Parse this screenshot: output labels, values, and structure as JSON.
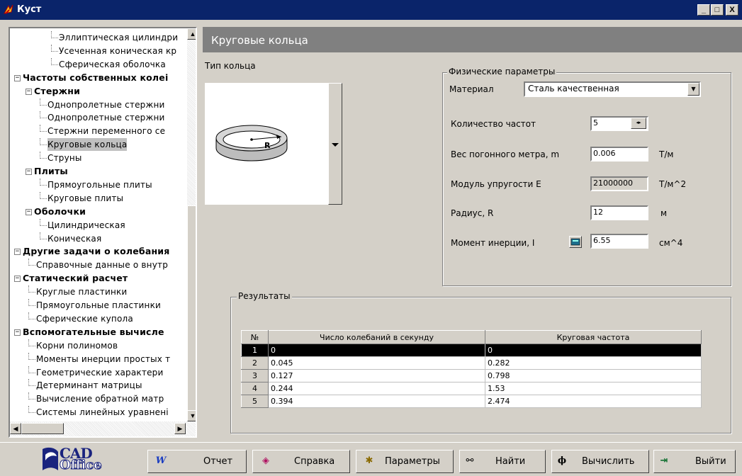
{
  "window": {
    "title": "Куст",
    "minimize": "_",
    "maximize": "□",
    "close": "X"
  },
  "tree": [
    {
      "label": "Эллиптическая цилиндри",
      "level": 3
    },
    {
      "label": "Усеченная коническая кр",
      "level": 3
    },
    {
      "label": "Сферическая оболочка",
      "level": 3
    },
    {
      "label": "Частоты собственных колеі",
      "level": 0,
      "bold": true,
      "toggle": "minus"
    },
    {
      "label": "Стержни",
      "level": 1,
      "bold": true,
      "toggle": "minus"
    },
    {
      "label": "Однопролетные стержни",
      "level": 2
    },
    {
      "label": "Однопролетные стержни",
      "level": 2
    },
    {
      "label": "Стержни переменного се",
      "level": 2
    },
    {
      "label": "Круговые кольца",
      "level": 2,
      "selected": true
    },
    {
      "label": "Струны",
      "level": 2
    },
    {
      "label": "Плиты",
      "level": 1,
      "bold": true,
      "toggle": "minus"
    },
    {
      "label": "Прямоугольные плиты",
      "level": 2
    },
    {
      "label": "Круговые плиты",
      "level": 2
    },
    {
      "label": "Оболочки",
      "level": 1,
      "bold": true,
      "toggle": "minus"
    },
    {
      "label": "Цилиндрическая",
      "level": 2
    },
    {
      "label": "Коническая",
      "level": 2
    },
    {
      "label": "Другие задачи о колебания",
      "level": 0,
      "bold": true,
      "toggle": "minus"
    },
    {
      "label": "Справочные данные о внутр",
      "level": 1
    },
    {
      "label": "Статический расчет",
      "level": 0,
      "bold": true,
      "toggle": "minus"
    },
    {
      "label": "Круглые пластинки",
      "level": 1
    },
    {
      "label": "Прямоугольные пластинки",
      "level": 1
    },
    {
      "label": "Сферические купола",
      "level": 1
    },
    {
      "label": "Вспомогательные вычисле",
      "level": 0,
      "bold": true,
      "toggle": "minus"
    },
    {
      "label": "Корни полиномов",
      "level": 1
    },
    {
      "label": "Моменты инерции простых т",
      "level": 1
    },
    {
      "label": "Геометрические характери",
      "level": 1
    },
    {
      "label": "Детерминант матрицы",
      "level": 1
    },
    {
      "label": "Вычисление обратной матр",
      "level": 1
    },
    {
      "label": "Системы линейных уравнені",
      "level": 1
    }
  ],
  "panel": {
    "header": "Круговые кольца",
    "ring_type_label": "Тип кольца",
    "ring_radius_label": "R"
  },
  "physical": {
    "group_title": "Физические параметры",
    "material_label": "Материал",
    "material_value": "Сталь качественная",
    "freq_count_label": "Количество частот",
    "freq_count_value": "5",
    "weight_label": "Вес погонного метра, m",
    "weight_value": "0.006",
    "weight_unit": "Т/м",
    "modulus_label": "Модуль упругости E",
    "modulus_value": "21000000",
    "modulus_unit": "Т/м^2",
    "radius_label": "Радиус, R",
    "radius_value": "12",
    "radius_unit": "м",
    "inertia_label": "Момент инерции, I",
    "inertia_value": "6.55",
    "inertia_unit": "см^4"
  },
  "results": {
    "group_title": "Результаты",
    "columns": [
      "№",
      "Число колебаний в секунду",
      "Круговая частота"
    ],
    "rows": [
      [
        "1",
        "0",
        "0"
      ],
      [
        "2",
        "0.045",
        "0.282"
      ],
      [
        "3",
        "0.127",
        "0.798"
      ],
      [
        "4",
        "0.244",
        "1.53"
      ],
      [
        "5",
        "0.394",
        "2.474"
      ]
    ]
  },
  "logo": {
    "line1": "CAD",
    "line2": "Office"
  },
  "buttons": {
    "report": "Отчет",
    "help": "Справка",
    "params": "Параметры",
    "find": "Найти",
    "compute": "Вычислить",
    "exit": "Выйти"
  },
  "colors": {
    "titlebar": "#0a246a",
    "header": "#808080",
    "face": "#d4d0c8",
    "logo": "#1a237e"
  }
}
